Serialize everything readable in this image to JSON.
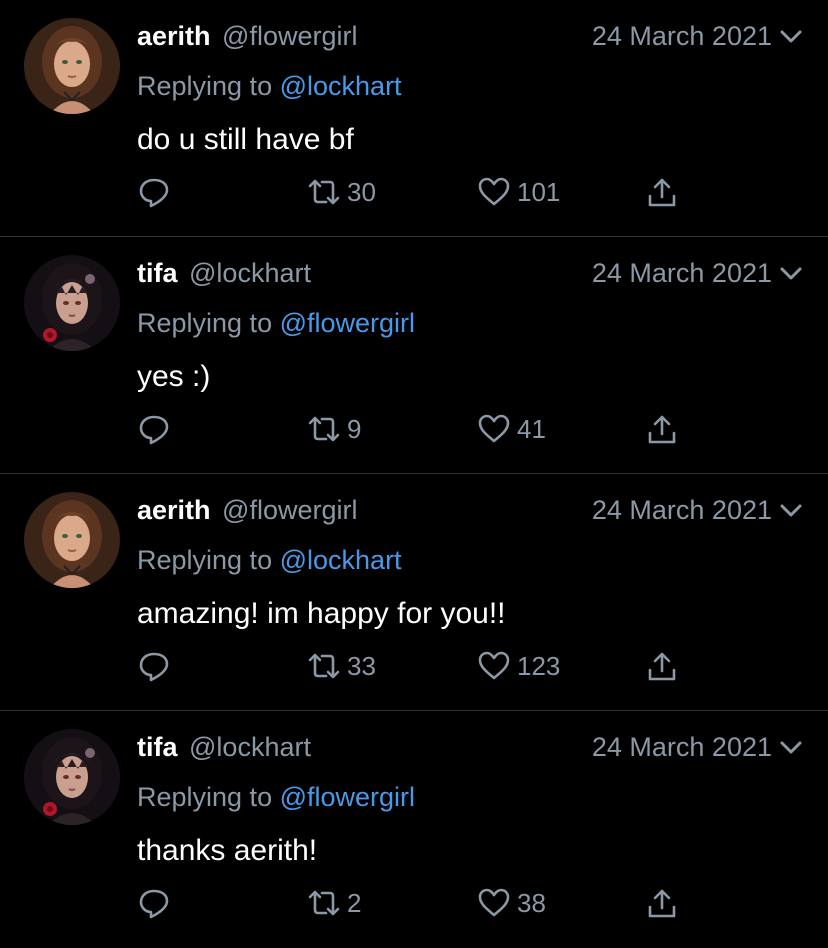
{
  "colors": {
    "background": "#000000",
    "primary_text": "#ffffff",
    "secondary_text": "#8b98a5",
    "mention": "#4a99e9",
    "divider": "#2f3336"
  },
  "icons": {
    "reply": "reply-icon",
    "retweet": "retweet-icon",
    "like": "heart-icon",
    "share": "share-icon",
    "menu": "chevron-down-icon"
  },
  "replying_label": "Replying to",
  "tweets": [
    {
      "name": "aerith",
      "handle": "@flowergirl",
      "date": "24 March 2021",
      "replying_to": "@lockhart",
      "text": "do u still have bf",
      "retweets": "30",
      "likes": "101"
    },
    {
      "name": "tifa",
      "handle": "@lockhart",
      "date": "24 March 2021",
      "replying_to": "@flowergirl",
      "text": "yes :)",
      "retweets": "9",
      "likes": "41"
    },
    {
      "name": "aerith",
      "handle": "@flowergirl",
      "date": "24 March 2021",
      "replying_to": "@lockhart",
      "text": "amazing! im happy for you!!",
      "retweets": "33",
      "likes": "123"
    },
    {
      "name": "tifa",
      "handle": "@lockhart",
      "date": "24 March 2021",
      "replying_to": "@flowergirl",
      "text": "thanks aerith!",
      "retweets": "2",
      "likes": "38"
    }
  ]
}
